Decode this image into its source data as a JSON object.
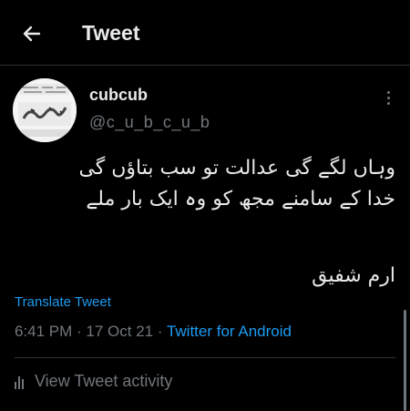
{
  "header": {
    "title": "Tweet",
    "back_icon": "arrow-left-icon"
  },
  "author": {
    "name": "cubcub",
    "handle": "@c_u_b_c_u_b",
    "avatar_icon": "profile-avatar-image"
  },
  "tweet": {
    "lines": [
      "وہاں لگے گی عدالت تو سب بتاؤں گی",
      "خدا کے سامنے مجھ کو وہ ایک بار ملے"
    ],
    "signature": "ارم شفیق"
  },
  "translate_label": "Translate Tweet",
  "meta": {
    "time": "6:41 PM",
    "separator": " · ",
    "date": "17 Oct 21",
    "source": "Twitter for Android"
  },
  "activity_label": "View Tweet activity",
  "colors": {
    "accent": "#1d9bf0",
    "text": "#e7e9ea",
    "muted": "#71767b",
    "background": "#000000"
  }
}
